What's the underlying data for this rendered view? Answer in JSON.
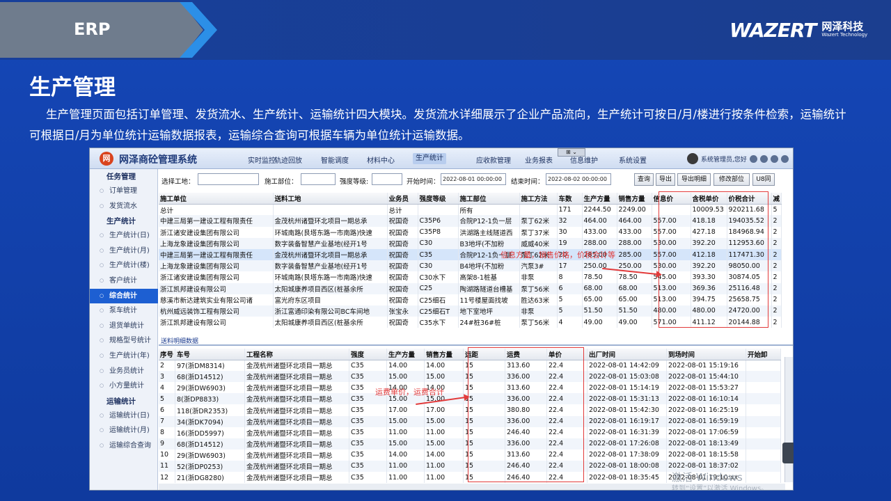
{
  "slide": {
    "tag": "ERP",
    "brand_logo": "WAZERT",
    "brand_cn": "网泽科技",
    "brand_en": "Wazert Technology",
    "title": "生产管理",
    "description": "生产管理页面包括订单管理、发货流水、生产统计、运输统计四大模块。发货流水详细展示了企业产品流向，生产统计可按日/月/楼进行按条件检索，运输统计可根据日/月为单位统计运输数据报表，运输综合查询可根据车辆为单位统计运输数据。"
  },
  "app": {
    "logo_char": "网",
    "name": "网泽商砼管理系统",
    "nav": [
      "实时监控",
      "轨迹回放",
      "智能调度",
      "材料中心",
      "生产统计",
      "应收款管理",
      "业务报表",
      "信息维护",
      "系统设置"
    ],
    "active_nav": "生产统计",
    "user": "系统管理员,您好",
    "float_tool": "⊞ ⌄"
  },
  "sidebar": {
    "groups": [
      {
        "title": "任务管理",
        "items": [
          "订单管理",
          "发货流水"
        ]
      },
      {
        "title": "生产统计",
        "items": [
          "生产统计(日)",
          "生产统计(月)",
          "生产统计(楼)",
          "客户统计",
          "综合统计",
          "泵车统计",
          "退货单统计",
          "规格型号统计",
          "生产统计(年)",
          "业务员统计",
          "小方量统计"
        ]
      },
      {
        "title": "运输统计",
        "items": [
          "运输统计(日)",
          "运输统计(月)",
          "运输综合查询"
        ]
      }
    ],
    "active_item": "综合统计"
  },
  "filter": {
    "site_label": "选择工地：",
    "site_value": "",
    "part_label": "施工部位：",
    "part_value": "",
    "grade_label": "强度等级:",
    "grade_value": "",
    "start_label": "开始时间：",
    "start_value": "2022-08-01 00:00:00",
    "end_label": "结束时间：",
    "end_value": "2022-08-02 00:00:00",
    "buttons": [
      "查询",
      "导出",
      "导出明细",
      "修改部位",
      "U8同"
    ]
  },
  "table1": {
    "columns": [
      "施工单位",
      "送料工地",
      "业务员",
      "强度等级",
      "施工部位",
      "施工方法",
      "车数",
      "生产方量",
      "销售方量",
      "信息价",
      "含税单价",
      "价税合计",
      "减"
    ],
    "rows": [
      [
        "总计",
        "",
        "总计",
        "",
        "所有",
        "",
        "171",
        "2244.50",
        "2249.00",
        "",
        "10009.53",
        "920211.68",
        "5"
      ],
      [
        "中建三局第一建设工程有限责任",
        "金茂杭州诸暨环北项目一期总承",
        "祝国奇",
        "C35P6",
        "合院P12-1负一层",
        "泵丁62米",
        "32",
        "464.00",
        "464.00",
        "557.00",
        "418.18",
        "194035.52",
        "2"
      ],
      [
        "浙江诸安建设集团有限公司",
        "环城南路(艮塔东路一市南路)快速",
        "祝国奇",
        "C35P8",
        "洪湖路主线隧道西",
        "泵丁37米",
        "30",
        "433.00",
        "433.00",
        "557.00",
        "427.18",
        "184968.94",
        "2"
      ],
      [
        "上海龙象建设集团有限公司",
        "数字装备智慧产业基地(经开1号",
        "祝国奇",
        "C30",
        "B3地坪(不加粉",
        "威威40米",
        "19",
        "288.00",
        "288.00",
        "530.00",
        "392.20",
        "112953.60",
        "2"
      ],
      [
        "中建三局第一建设工程有限责任",
        "金茂杭州诸暨环北项目一期总承",
        "祝国奇",
        "C35",
        "合院P12-1负一层",
        "泵丁62米",
        "20",
        "285.00",
        "285.00",
        "557.00",
        "412.18",
        "117471.30",
        "2"
      ],
      [
        "上海龙象建设集团有限公司",
        "数字装备智慧产业基地(经开1号",
        "祝国奇",
        "C30",
        "B4地坪(不加粉",
        "汽泵3#",
        "17",
        "250.00",
        "250.00",
        "530.00",
        "392.20",
        "98050.00",
        "2"
      ],
      [
        "浙江诸安建设集团有限公司",
        "环城南路(艮塔东路一市南路)快速",
        "祝国奇",
        "C30水下",
        "高架8-1桩基",
        "非泵",
        "8",
        "78.50",
        "78.50",
        "545.00",
        "393.30",
        "30874.05",
        "2"
      ],
      [
        "浙江凯邦建设有限公司",
        "太阳城康养项目西区(桩基余所",
        "祝国奇",
        "C25",
        "陶湖路隧道台槽基",
        "泵丁56米",
        "6",
        "68.00",
        "68.00",
        "513.00",
        "369.36",
        "25116.48",
        "2"
      ],
      [
        "慈溪市新达建筑实业有限公司诸",
        "富光府东区项目",
        "祝国奇",
        "C25细石",
        "11号楼屋面找坡",
        "胜达63米",
        "5",
        "65.00",
        "65.00",
        "513.00",
        "394.75",
        "25658.75",
        "2"
      ],
      [
        "杭州威远装饰工程有限公司",
        "浙江富通印染有限公司BC车间地",
        "张宝永",
        "C25细石T",
        "地下室地坪",
        "非泵",
        "5",
        "51.50",
        "51.50",
        "480.00",
        "480.00",
        "24720.00",
        "2"
      ],
      [
        "浙江凯邦建设有限公司",
        "太阳城康养项目西区(桩基余所",
        "祝国奇",
        "C35水下",
        "24#桩36#桩",
        "泵丁56米",
        "4",
        "49.00",
        "49.00",
        "571.00",
        "411.12",
        "20144.88",
        "2"
      ]
    ]
  },
  "table2": {
    "subtitle": "送料明细数据",
    "columns": [
      "序号",
      "车号",
      "工程名称",
      "强度",
      "生产方量",
      "销售方量",
      "运距",
      "运费",
      "单价",
      "出厂时间",
      "到场时间",
      "开始卸"
    ],
    "rows": [
      [
        "2",
        "97(浙DM8314)",
        "金茂杭州诸暨环北项目一期总",
        "C35",
        "14.00",
        "14.00",
        "15",
        "313.60",
        "22.4",
        "2022-08-01 14:42:09",
        "2022-08-01 15:19:16",
        ""
      ],
      [
        "3",
        "68(浙D14512)",
        "金茂杭州诸暨环北项目一期总",
        "C35",
        "15.00",
        "15.00",
        "15",
        "336.00",
        "22.4",
        "2022-08-01 15:03:08",
        "2022-08-01 15:44:10",
        ""
      ],
      [
        "4",
        "29(浙DW6903)",
        "金茂杭州诸暨环北项目一期总",
        "C35",
        "14.00",
        "14.00",
        "15",
        "313.60",
        "22.4",
        "2022-08-01 15:14:19",
        "2022-08-01 15:53:27",
        ""
      ],
      [
        "5",
        "8(浙DP8833)",
        "金茂杭州诸暨环北项目一期总",
        "C35",
        "15.00",
        "15.00",
        "15",
        "336.00",
        "22.4",
        "2022-08-01 15:31:13",
        "2022-08-01 16:10:14",
        ""
      ],
      [
        "6",
        "118(浙DR2353)",
        "金茂杭州诸暨环北项目一期总",
        "C35",
        "17.00",
        "17.00",
        "15",
        "380.80",
        "22.4",
        "2022-08-01 15:42:30",
        "2022-08-01 16:25:19",
        ""
      ],
      [
        "7",
        "34(浙DK7094)",
        "金茂杭州诸暨环北项目一期总",
        "C35",
        "15.00",
        "15.00",
        "15",
        "336.00",
        "22.4",
        "2022-08-01 16:19:17",
        "2022-08-01 16:59:19",
        ""
      ],
      [
        "8",
        "16(浙DD5997)",
        "金茂杭州诸暨环北项目一期总",
        "C35",
        "11.00",
        "11.00",
        "15",
        "246.40",
        "22.4",
        "2022-08-01 16:31:39",
        "2022-08-01 17:06:59",
        ""
      ],
      [
        "9",
        "68(浙D14512)",
        "金茂杭州诸暨环北项目一期总",
        "C35",
        "15.00",
        "15.00",
        "15",
        "336.00",
        "22.4",
        "2022-08-01 17:26:08",
        "2022-08-01 18:13:49",
        ""
      ],
      [
        "10",
        "29(浙DW6903)",
        "金茂杭州诸暨环北项目一期总",
        "C35",
        "14.00",
        "14.00",
        "15",
        "313.60",
        "22.4",
        "2022-08-01 17:38:09",
        "2022-08-01 18:15:58",
        ""
      ],
      [
        "11",
        "52(浙DP0253)",
        "金茂杭州诸暨环北项目一期总",
        "C35",
        "11.00",
        "11.00",
        "15",
        "246.40",
        "22.4",
        "2022-08-01 18:00:08",
        "2022-08-01 18:37:02",
        ""
      ],
      [
        "12",
        "21(浙DG8280)",
        "金茂杭州诸暨环北项目一期总",
        "C35",
        "11.00",
        "11.00",
        "15",
        "246.40",
        "22.4",
        "2022-08-01 18:35:45",
        "2022-08-01 19:10:xx",
        ""
      ]
    ]
  },
  "annotations": {
    "top": "信息方量，销售价格，价税合计等",
    "bottom": "运费单价，运费合计"
  },
  "watermark": {
    "line1": "激活 Windows",
    "line2": "转到“设置”以激活 Windows。"
  },
  "colors": {
    "accent_red": "#e23a3a",
    "slide_blue": "#1547b7",
    "active_blue": "#1d5fd2"
  }
}
